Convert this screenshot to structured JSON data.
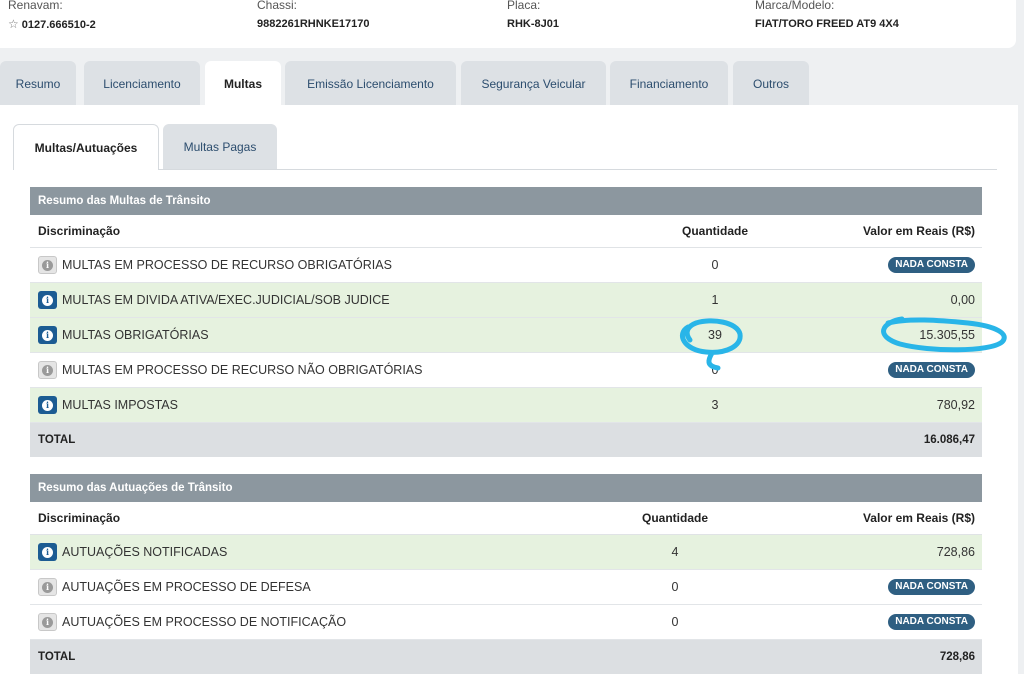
{
  "vehicle": {
    "renavam_label": "Renavam:",
    "renavam_value": "0127.666510-2",
    "chassi_label": "Chassi:",
    "chassi_value": "9882261RHNKE17170",
    "placa_label": "Placa:",
    "placa_value": "RHK-8J01",
    "marca_label": "Marca/Modelo:",
    "marca_value": "FIAT/TORO FREED AT9 4X4"
  },
  "tabs": [
    {
      "label": "Resumo"
    },
    {
      "label": "Licenciamento"
    },
    {
      "label": "Multas"
    },
    {
      "label": "Emissão Licenciamento"
    },
    {
      "label": "Segurança Veicular"
    },
    {
      "label": "Financiamento"
    },
    {
      "label": "Outros"
    }
  ],
  "active_tab": "Multas",
  "subtabs": [
    {
      "label": "Multas/Autuações"
    },
    {
      "label": "Multas Pagas"
    }
  ],
  "fines": {
    "title": "Resumo das Multas de Trânsito",
    "col_desc": "Discriminação",
    "col_qty": "Quantidade",
    "col_value": "Valor em Reais (R$)",
    "rows": [
      {
        "desc": "MULTAS EM PROCESSO DE RECURSO OBRIGATÓRIAS",
        "qty": "0",
        "value": "NADA CONSTA"
      },
      {
        "desc": "MULTAS EM DIVIDA ATIVA/EXEC.JUDICIAL/SOB JUDICE",
        "qty": "1",
        "value": "0,00"
      },
      {
        "desc": "MULTAS OBRIGATÓRIAS",
        "qty": "39",
        "value": "15.305,55"
      },
      {
        "desc": "MULTAS EM PROCESSO DE RECURSO NÃO OBRIGATÓRIAS",
        "qty": "0",
        "value": "NADA CONSTA"
      },
      {
        "desc": "MULTAS IMPOSTAS",
        "qty": "3",
        "value": "780,92"
      }
    ],
    "total_label": "TOTAL",
    "total_value": "16.086,47"
  },
  "infractions": {
    "title": "Resumo das Autuações de Trânsito",
    "col_desc": "Discriminação",
    "col_qty": "Quantidade",
    "col_value": "Valor em Reais (R$)",
    "rows": [
      {
        "desc": "AUTUAÇÕES NOTIFICADAS",
        "qty": "4",
        "value": "728,86"
      },
      {
        "desc": "AUTUAÇÕES EM PROCESSO DE DEFESA",
        "qty": "0",
        "value": "NADA CONSTA"
      },
      {
        "desc": "AUTUAÇÕES EM PROCESSO DE NOTIFICAÇÃO",
        "qty": "0",
        "value": "NADA CONSTA"
      }
    ],
    "total_label": "TOTAL",
    "total_value": "728,86"
  },
  "icons": {
    "favorite": "star-icon",
    "row_info": "info-icon"
  },
  "colors": {
    "section_header": "#8c979f",
    "row_green": "#e6f2df",
    "badge": "#2f5f82",
    "info_active": "#1c5c93",
    "annotation": "#29b5e8"
  }
}
